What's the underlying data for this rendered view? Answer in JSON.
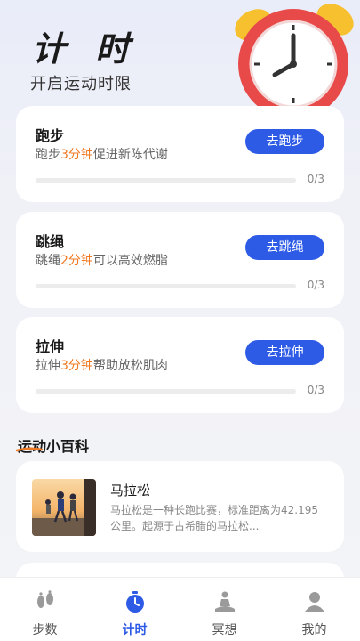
{
  "header": {
    "title": "计 时",
    "subtitle": "开启运动时限"
  },
  "exercises": [
    {
      "name": "跑步",
      "desc_prefix": "跑步",
      "desc_highlight": "3分钟",
      "desc_suffix": "促进新陈代谢",
      "button": "去跑步",
      "progress": 0,
      "count": "0/3"
    },
    {
      "name": "跳绳",
      "desc_prefix": "跳绳",
      "desc_highlight": "2分钟",
      "desc_suffix": "可以高效燃脂",
      "button": "去跳绳",
      "progress": 0,
      "count": "0/3"
    },
    {
      "name": "拉伸",
      "desc_prefix": "拉伸",
      "desc_highlight": "3分钟",
      "desc_suffix": "帮助放松肌肉",
      "button": "去拉伸",
      "progress": 0,
      "count": "0/3"
    }
  ],
  "encyclopedia": {
    "title": "运动小百科",
    "articles": [
      {
        "title": "马拉松",
        "body": "马拉松是一种长跑比赛，标准距离为42.195公里。起源于古希腊的马拉松..."
      }
    ]
  },
  "tabs": [
    {
      "label": "步数",
      "icon": "footprint-icon",
      "active": false
    },
    {
      "label": "计时",
      "icon": "stopwatch-icon",
      "active": true
    },
    {
      "label": "冥想",
      "icon": "meditation-icon",
      "active": false
    },
    {
      "label": "我的",
      "icon": "person-icon",
      "active": false
    }
  ],
  "colors": {
    "accent": "#2e5be6",
    "highlight": "#f07a24",
    "clock": "#e84a4a",
    "bell": "#f6c02f"
  }
}
